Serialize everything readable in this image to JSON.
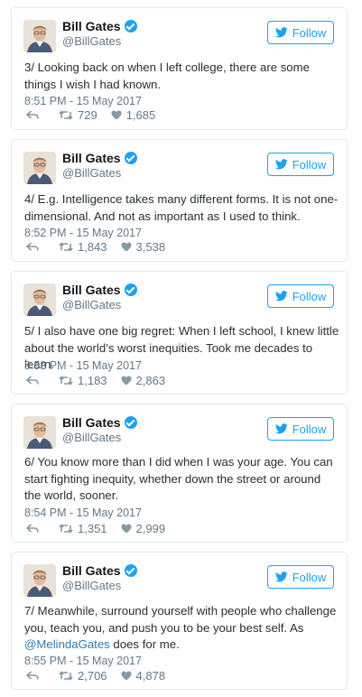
{
  "tweets": [
    {
      "name": "Bill Gates",
      "handle": "@BillGates",
      "follow_label": "Follow",
      "text": "3/ Looking back on when I left college, there are some things I wish I had known.",
      "time": "8:51 PM - 15 May 2017",
      "retweets": "729",
      "likes": "1,685"
    },
    {
      "name": "Bill Gates",
      "handle": "@BillGates",
      "follow_label": "Follow",
      "text": "4/ E.g. Intelligence takes many different forms. It is not one-dimensional. And not as important as I used to think.",
      "time": "8:52 PM - 15 May 2017",
      "retweets": "1,843",
      "likes": "3,538"
    },
    {
      "name": "Bill Gates",
      "handle": "@BillGates",
      "follow_label": "Follow",
      "text": "5/ I also have one big regret: When I left school, I knew little about the world’s worst inequities. Took me decades to learn.",
      "time": "8:53 PM - 15 May 2017",
      "retweets": "1,183",
      "likes": "2,863"
    },
    {
      "name": "Bill Gates",
      "handle": "@BillGates",
      "follow_label": "Follow",
      "text": "6/ You know more than I did when I was your age. You can start fighting inequity, whether down the street or around the world, sooner.",
      "time": "8:54 PM - 15 May 2017",
      "retweets": "1,351",
      "likes": "2,999"
    },
    {
      "name": "Bill Gates",
      "handle": "@BillGates",
      "follow_label": "Follow",
      "text": "7/ Meanwhile, surround yourself with people who challenge you, teach you, and push you to be your best self. As",
      "mention": "@MelindaGates",
      "text_after": " does for me.",
      "time": "8:55 PM - 15 May 2017",
      "retweets": "2,706",
      "likes": "4,878"
    }
  ],
  "colors": {
    "accent": "#1da1f2",
    "meta": "#657786",
    "border": "#e1e8ed",
    "mention": "#2b7bb9"
  },
  "icons": [
    "verified-icon",
    "bird-icon",
    "reply-icon",
    "retweet-icon",
    "heart-icon"
  ]
}
